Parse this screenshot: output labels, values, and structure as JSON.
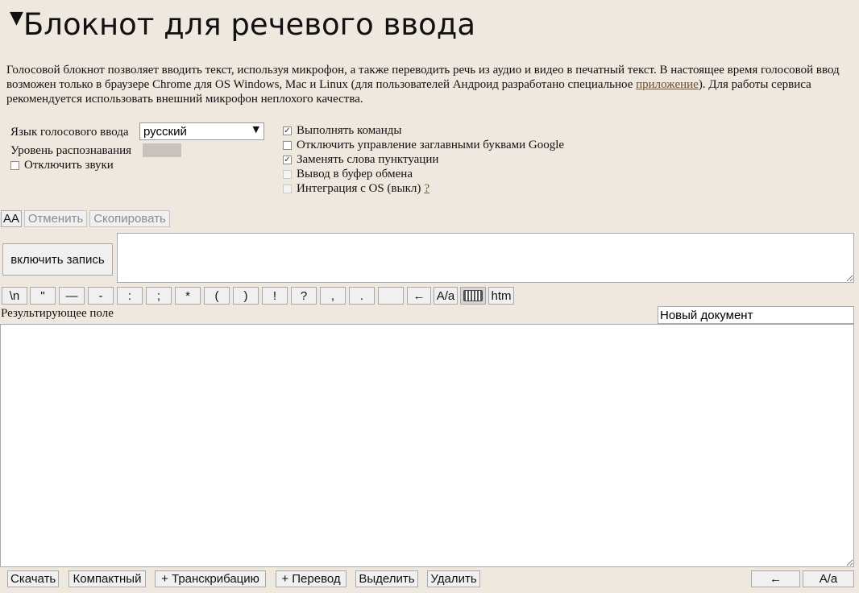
{
  "header": {
    "triangle": "▼",
    "title": "Блокнот для речевого ввода"
  },
  "description": {
    "text_before_link": "Голосовой блокнот позволяет вводить текст, используя микрофон, а также переводить речь из аудио и видео в печатный текст. В настоящее время голосовой ввод возможен только в браузере Chrome для OS Windows, Mac и Linux (для пользователей Андроид разработано специальное ",
    "link": "приложение",
    "text_after_link": "). Для работы сервиса рекомендуется использовать внешний микрофон неплохого качества."
  },
  "settings": {
    "language_label": "Язык голосового ввода",
    "language_value": "русский",
    "level_label": "Уровень распознавания",
    "recognition_level": 0,
    "mute_sounds": {
      "label": "Отключить звуки",
      "checked": false
    }
  },
  "options": [
    {
      "label": "Выполнять команды",
      "checked": true,
      "disabled": false
    },
    {
      "label": "Отключить управление заглавными буквами Google",
      "checked": false,
      "disabled": false
    },
    {
      "label": "Заменять слова пунктуации",
      "checked": true,
      "disabled": false
    },
    {
      "label": "Вывод в буфер обмена",
      "checked": false,
      "disabled": true
    },
    {
      "label": "Интеграция с OS (выкл)",
      "checked": false,
      "disabled": true,
      "help": "?"
    }
  ],
  "toolbar": {
    "aa": "AA",
    "undo": "Отменить",
    "copy": "Скопировать",
    "record": "включить запись"
  },
  "symbols": [
    "\\n",
    "\"",
    "—",
    "-",
    ":",
    ";",
    "*",
    "(",
    ")",
    "!",
    "?",
    ",",
    ".",
    " ",
    "←",
    "A/a"
  ],
  "keyboard_icon": "keyboard-icon",
  "htm": "htm",
  "result": {
    "label": "Результирующее поле",
    "doc_name": "Новый документ",
    "text": ""
  },
  "bottom": {
    "download": "Скачать",
    "compact": "Компактный",
    "transcribe": "+ Транскрибацию",
    "translate": "+ Перевод",
    "select": "Выделить",
    "delete": "Удалить",
    "back": "←",
    "case": "A/a"
  }
}
